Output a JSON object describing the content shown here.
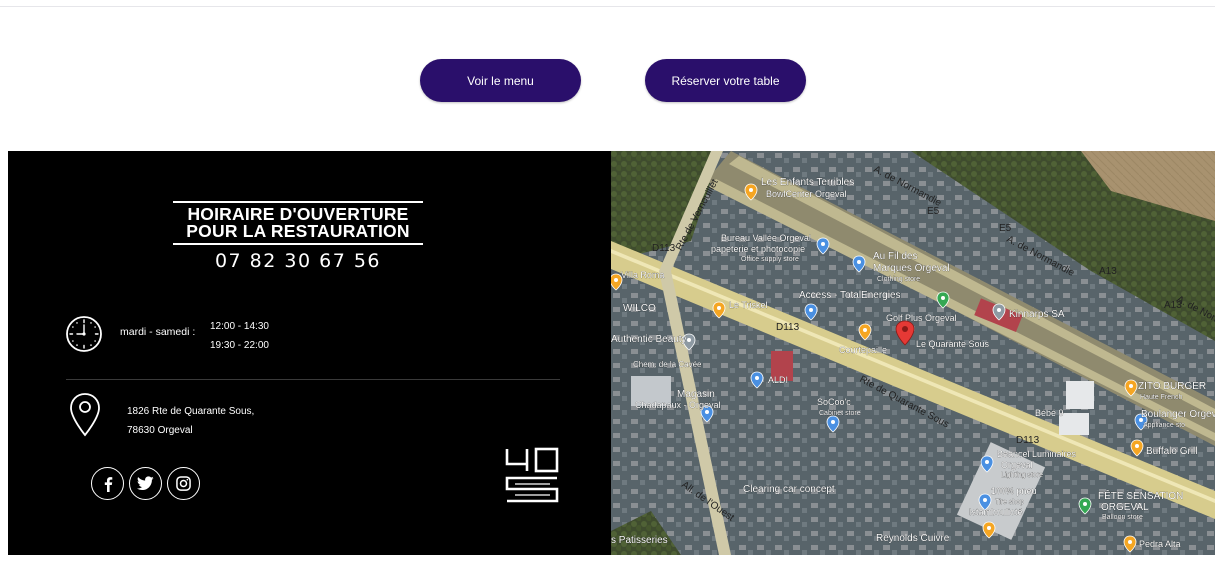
{
  "buttons": {
    "menu_label": "Voir le menu",
    "reserve_label": "Réserver votre table"
  },
  "footer": {
    "title_line1": "HOIRAIRE D'OUVERTURE",
    "title_line2": "POUR LA RESTAURATION",
    "phone": "07 82 30 67 56",
    "days": "mardi - samedi :",
    "hours_lunch": "12:00 - 14:30",
    "hours_dinner": "19:30 - 22:00",
    "address_line1": "1826 Rte de Quarante Sous,",
    "address_line2": "78630 Orgeval",
    "socials": [
      "facebook-icon",
      "twitter-icon",
      "instagram-icon"
    ],
    "logo_text": "40S"
  },
  "map": {
    "labels": {
      "enfants": "Les Enfants Terribles",
      "bowl": "BowlCenter Orgeval",
      "normandie1": "A. de Normandie",
      "normandie2": "A. de Normandie",
      "normandie3": "A. de Normandie",
      "vernouillet": "Rte de Vernouillet",
      "bureau": "Bureau Vallée Orgeval",
      "papeterie": "papeterie et photocopie",
      "office": "Office supply store",
      "aufil": "Au Fil des",
      "marques": "Marques Orgeval",
      "clothing": "Clothing store",
      "villaroma": "Villa Roma",
      "wilco": "WILCO",
      "letriskel": "Le Triskel",
      "access": "Access - TotalEnergies",
      "golfplus": "Golf Plus Orgeval",
      "kinnarps": "Kinnarps SA",
      "authentic": "Authentic Beauty",
      "courtepaille": "Courtepaille",
      "quarante": "Le Quarante Sous",
      "chemcavee": "Chem. de la Cavée",
      "aldi": "ALDI",
      "rtequarante": "Rte de Quarante Sous",
      "magasin": "Magasin",
      "chadapaux": "Chadapaux - Orgeval",
      "socoo": "SoCoo'c",
      "cabinet": "Cabinet store",
      "zito": "ZITO BURGER",
      "hautefrench": "Haute French",
      "boulanger": "Boulanger Orgev",
      "appliance": "Appliance sto",
      "bebe9": "Bébé 9",
      "buffalo": "Buffalo Grill",
      "beancel": "Beancel Luminaires",
      "orgeval": "Orgeval",
      "lighting": "Lighting store",
      "pneu": "100% pneu",
      "tire": "Tire shop",
      "istam": "Istamboulioté",
      "fete": "FÊTE SENSATION",
      "feteorgeval": "ORGEVAL",
      "balloon": "Balloon store",
      "clearing": "Clearing car concept",
      "reynolds": "Reynolds Cuivre",
      "pedra": "Pedra Alta",
      "patisseries": "s Patisseries",
      "allee": "All. de l'Ouest",
      "d113a": "D113",
      "d113b": "D113",
      "d113c": "D113",
      "a13a": "A13",
      "a13b": "A13",
      "e5a": "E5",
      "e5b": "E5"
    }
  },
  "colors": {
    "button_bg": "#2a0f6b",
    "footer_bg": "#000000",
    "pin_red": "#e53935",
    "poi_orange": "#f5a623",
    "poi_blue": "#4a90e2"
  }
}
